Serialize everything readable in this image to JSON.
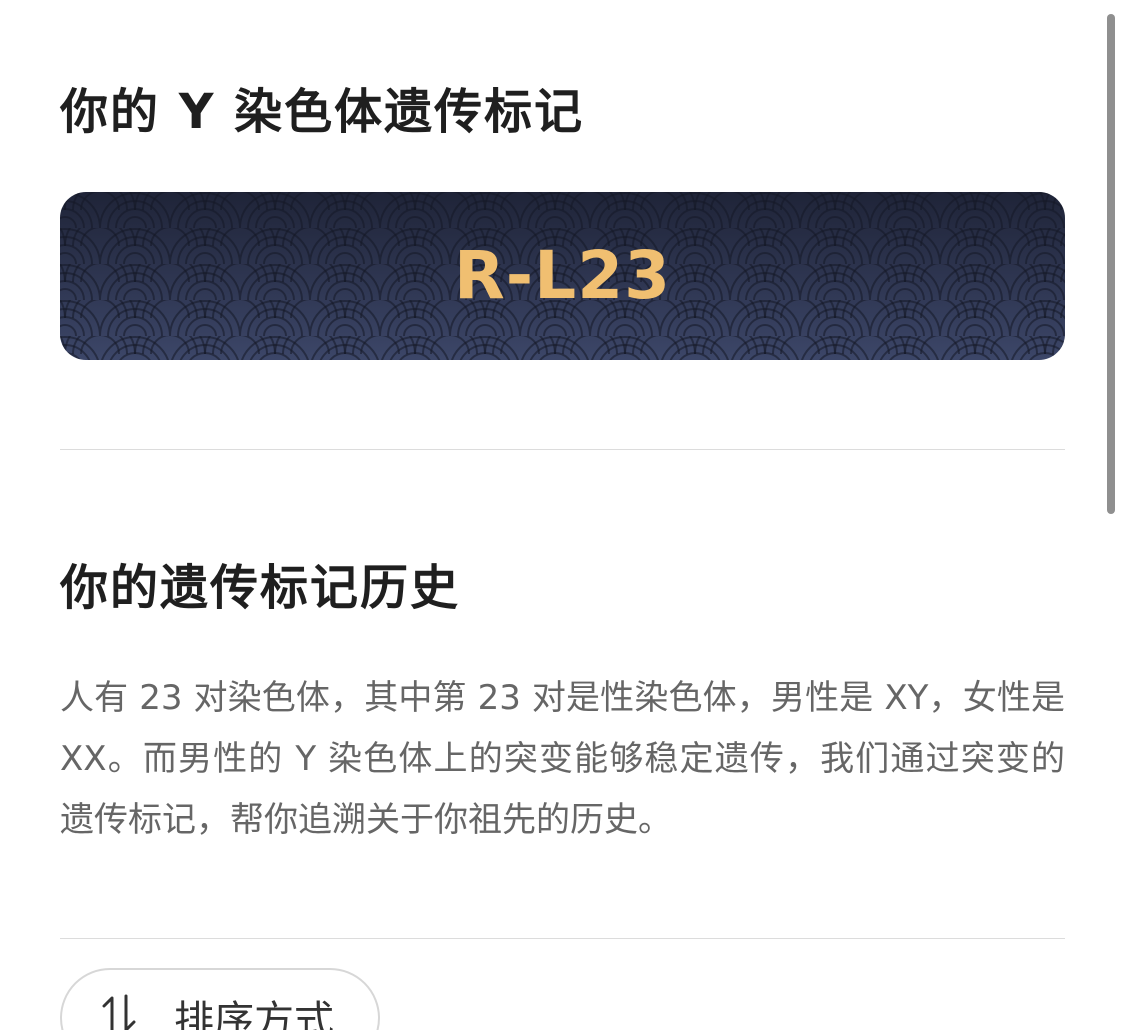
{
  "ymarker": {
    "title": "你的 Y 染色体遗传标记",
    "code": "R-L23",
    "code_color": "#f0bf71"
  },
  "history": {
    "title": "你的遗传标记历史",
    "description": "人有 23 对染色体，其中第 23 对是性染色体，男性是 XY，女性是 XX。而男性的 Y 染色体上的突变能够稳定遗传，我们通过突变的遗传标记，帮你追溯关于你祖先的历史。"
  },
  "sort": {
    "label": "排序方式",
    "icon": "sort-icon"
  },
  "colors": {
    "card_gradient_top": "#1f2438",
    "card_gradient_bottom": "#3c4668",
    "text_primary": "#1f1f1f",
    "text_secondary": "#666666"
  }
}
